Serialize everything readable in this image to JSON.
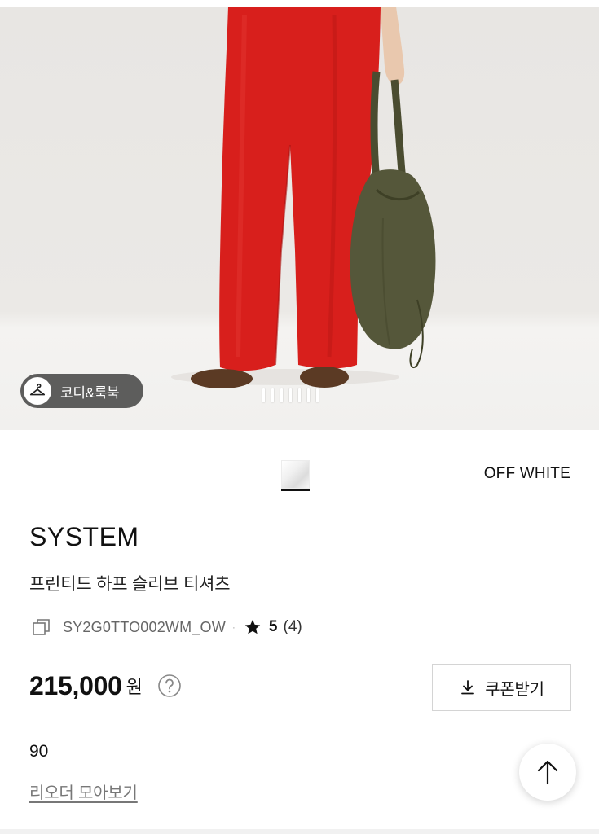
{
  "hero": {
    "look_button_label": "코디&룩북",
    "pager_count": 7
  },
  "color": {
    "name": "OFF WHITE"
  },
  "product": {
    "brand": "SYSTEM",
    "name": "프린티드 하프 슬리브 티셔츠",
    "code": "SY2G0TTO002WM_OW",
    "code_separator": "·",
    "rating": "5",
    "review_count": "(4)",
    "price": "215,000",
    "currency": "원",
    "coupon_label": "쿠폰받기",
    "points": "90",
    "reorder_link": "리오더 모아보기"
  },
  "icons": {
    "look": "hanger-icon",
    "copy": "copy-icon",
    "star": "star-icon",
    "help": "question-icon",
    "download": "download-icon",
    "top": "arrow-up-icon"
  },
  "colors": {
    "pants": "#d81f1c",
    "bag": "#55573a",
    "accent": "#111111"
  }
}
